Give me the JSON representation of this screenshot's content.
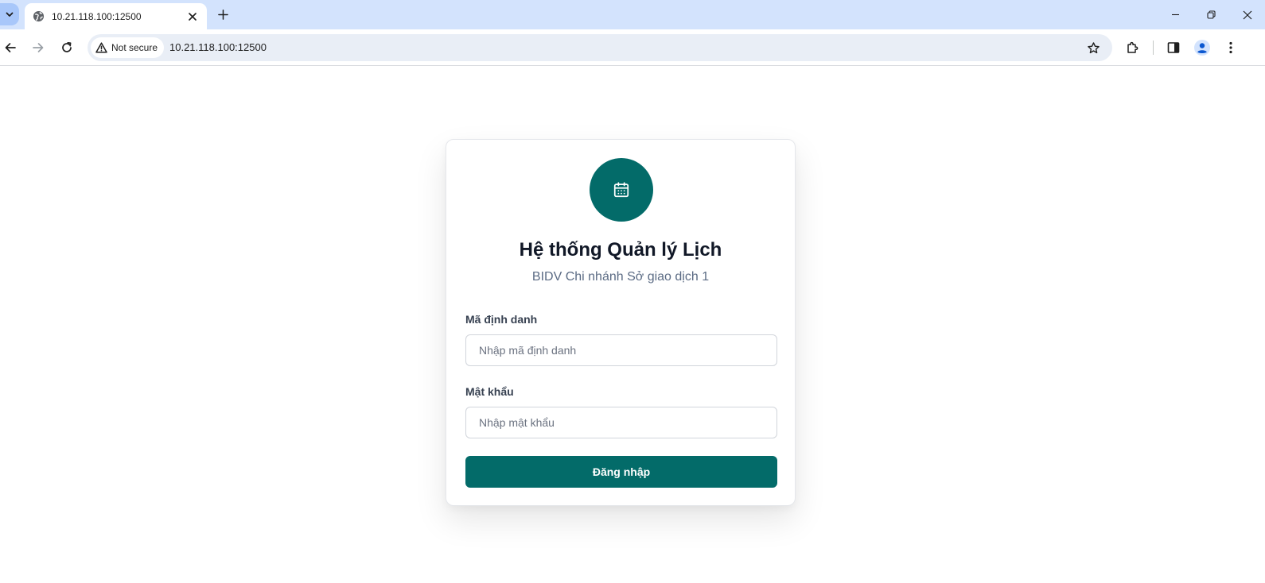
{
  "browser": {
    "tab_title": "10.21.118.100:12500",
    "security_label": "Not secure",
    "url": "10.21.118.100:12500"
  },
  "login": {
    "title": "Hệ thống Quản lý Lịch",
    "subtitle": "BIDV Chi nhánh Sở giao dịch 1",
    "id_label": "Mã định danh",
    "id_placeholder": "Nhập mã định danh",
    "password_label": "Mật khẩu",
    "password_placeholder": "Nhập mật khẩu",
    "submit_label": "Đăng nhập",
    "logo_icon": "calendar-icon"
  },
  "colors": {
    "brand": "#036b69",
    "tabbar": "#d3e3fd",
    "omnibox": "#e9eef6"
  }
}
